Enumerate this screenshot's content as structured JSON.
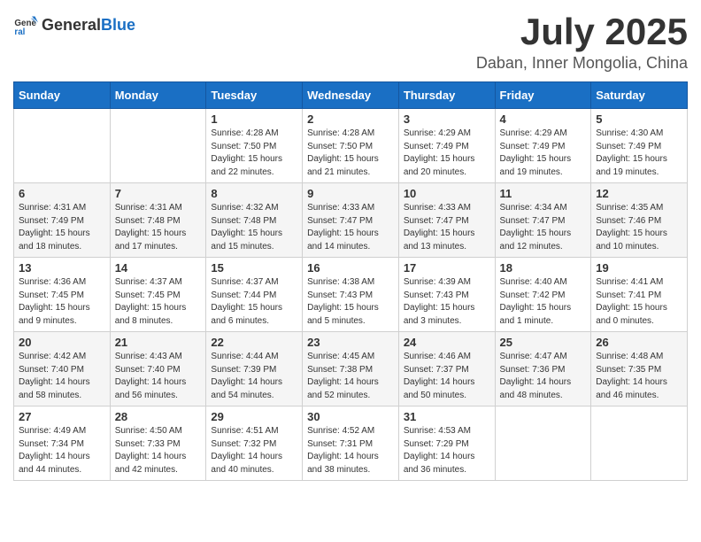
{
  "logo": {
    "general": "General",
    "blue": "Blue"
  },
  "title": "July 2025",
  "location": "Daban, Inner Mongolia, China",
  "weekdays": [
    "Sunday",
    "Monday",
    "Tuesday",
    "Wednesday",
    "Thursday",
    "Friday",
    "Saturday"
  ],
  "weeks": [
    [
      {
        "day": "",
        "detail": ""
      },
      {
        "day": "",
        "detail": ""
      },
      {
        "day": "1",
        "detail": "Sunrise: 4:28 AM\nSunset: 7:50 PM\nDaylight: 15 hours\nand 22 minutes."
      },
      {
        "day": "2",
        "detail": "Sunrise: 4:28 AM\nSunset: 7:50 PM\nDaylight: 15 hours\nand 21 minutes."
      },
      {
        "day": "3",
        "detail": "Sunrise: 4:29 AM\nSunset: 7:49 PM\nDaylight: 15 hours\nand 20 minutes."
      },
      {
        "day": "4",
        "detail": "Sunrise: 4:29 AM\nSunset: 7:49 PM\nDaylight: 15 hours\nand 19 minutes."
      },
      {
        "day": "5",
        "detail": "Sunrise: 4:30 AM\nSunset: 7:49 PM\nDaylight: 15 hours\nand 19 minutes."
      }
    ],
    [
      {
        "day": "6",
        "detail": "Sunrise: 4:31 AM\nSunset: 7:49 PM\nDaylight: 15 hours\nand 18 minutes."
      },
      {
        "day": "7",
        "detail": "Sunrise: 4:31 AM\nSunset: 7:48 PM\nDaylight: 15 hours\nand 17 minutes."
      },
      {
        "day": "8",
        "detail": "Sunrise: 4:32 AM\nSunset: 7:48 PM\nDaylight: 15 hours\nand 15 minutes."
      },
      {
        "day": "9",
        "detail": "Sunrise: 4:33 AM\nSunset: 7:47 PM\nDaylight: 15 hours\nand 14 minutes."
      },
      {
        "day": "10",
        "detail": "Sunrise: 4:33 AM\nSunset: 7:47 PM\nDaylight: 15 hours\nand 13 minutes."
      },
      {
        "day": "11",
        "detail": "Sunrise: 4:34 AM\nSunset: 7:47 PM\nDaylight: 15 hours\nand 12 minutes."
      },
      {
        "day": "12",
        "detail": "Sunrise: 4:35 AM\nSunset: 7:46 PM\nDaylight: 15 hours\nand 10 minutes."
      }
    ],
    [
      {
        "day": "13",
        "detail": "Sunrise: 4:36 AM\nSunset: 7:45 PM\nDaylight: 15 hours\nand 9 minutes."
      },
      {
        "day": "14",
        "detail": "Sunrise: 4:37 AM\nSunset: 7:45 PM\nDaylight: 15 hours\nand 8 minutes."
      },
      {
        "day": "15",
        "detail": "Sunrise: 4:37 AM\nSunset: 7:44 PM\nDaylight: 15 hours\nand 6 minutes."
      },
      {
        "day": "16",
        "detail": "Sunrise: 4:38 AM\nSunset: 7:43 PM\nDaylight: 15 hours\nand 5 minutes."
      },
      {
        "day": "17",
        "detail": "Sunrise: 4:39 AM\nSunset: 7:43 PM\nDaylight: 15 hours\nand 3 minutes."
      },
      {
        "day": "18",
        "detail": "Sunrise: 4:40 AM\nSunset: 7:42 PM\nDaylight: 15 hours\nand 1 minute."
      },
      {
        "day": "19",
        "detail": "Sunrise: 4:41 AM\nSunset: 7:41 PM\nDaylight: 15 hours\nand 0 minutes."
      }
    ],
    [
      {
        "day": "20",
        "detail": "Sunrise: 4:42 AM\nSunset: 7:40 PM\nDaylight: 14 hours\nand 58 minutes."
      },
      {
        "day": "21",
        "detail": "Sunrise: 4:43 AM\nSunset: 7:40 PM\nDaylight: 14 hours\nand 56 minutes."
      },
      {
        "day": "22",
        "detail": "Sunrise: 4:44 AM\nSunset: 7:39 PM\nDaylight: 14 hours\nand 54 minutes."
      },
      {
        "day": "23",
        "detail": "Sunrise: 4:45 AM\nSunset: 7:38 PM\nDaylight: 14 hours\nand 52 minutes."
      },
      {
        "day": "24",
        "detail": "Sunrise: 4:46 AM\nSunset: 7:37 PM\nDaylight: 14 hours\nand 50 minutes."
      },
      {
        "day": "25",
        "detail": "Sunrise: 4:47 AM\nSunset: 7:36 PM\nDaylight: 14 hours\nand 48 minutes."
      },
      {
        "day": "26",
        "detail": "Sunrise: 4:48 AM\nSunset: 7:35 PM\nDaylight: 14 hours\nand 46 minutes."
      }
    ],
    [
      {
        "day": "27",
        "detail": "Sunrise: 4:49 AM\nSunset: 7:34 PM\nDaylight: 14 hours\nand 44 minutes."
      },
      {
        "day": "28",
        "detail": "Sunrise: 4:50 AM\nSunset: 7:33 PM\nDaylight: 14 hours\nand 42 minutes."
      },
      {
        "day": "29",
        "detail": "Sunrise: 4:51 AM\nSunset: 7:32 PM\nDaylight: 14 hours\nand 40 minutes."
      },
      {
        "day": "30",
        "detail": "Sunrise: 4:52 AM\nSunset: 7:31 PM\nDaylight: 14 hours\nand 38 minutes."
      },
      {
        "day": "31",
        "detail": "Sunrise: 4:53 AM\nSunset: 7:29 PM\nDaylight: 14 hours\nand 36 minutes."
      },
      {
        "day": "",
        "detail": ""
      },
      {
        "day": "",
        "detail": ""
      }
    ]
  ]
}
